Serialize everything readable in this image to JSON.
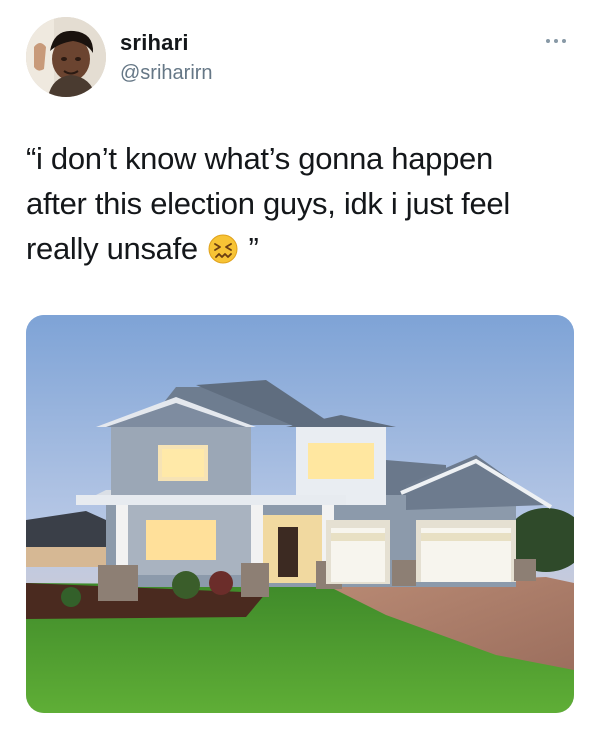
{
  "user": {
    "name": "srihari",
    "handle": "@sriharirn"
  },
  "tweet": {
    "line1": "“i don’t know what’s gonna happen",
    "line2": "after this election guys, idk i just feel",
    "line3_before": "really unsafe ",
    "line3_after": " ”",
    "emoji": "confounded-face"
  },
  "media": {
    "description_icon": "house-photo"
  },
  "colors": {
    "text": "#14171a",
    "secondary": "#657786"
  }
}
